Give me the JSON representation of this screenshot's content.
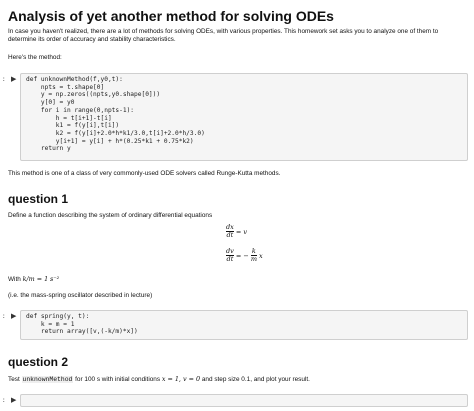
{
  "notebook": {
    "title": "Analysis of yet another method for solving ODEs",
    "intro": "In case you haven't realized, there are a lot of methods for solving ODEs, with various properties. This homework set asks you to analyze one of them to determine its order of accuracy and stability characteristics.",
    "method_label": "Here's the method:",
    "cell1_prompt": ":",
    "rk_note": "This method is one of a class of very commonly-used ODE solvers called Runge-Kutta methods.",
    "q1_heading": "question 1",
    "q1_text": "Define a function describing the system of ordinary differential equations",
    "eq1": {
      "num": "dx",
      "den": "dt",
      "rhs": "= v"
    },
    "eq2": {
      "num": "dv",
      "den": "dt",
      "eq": "= −",
      "knum": "k",
      "kden": "m",
      "tail": "x"
    },
    "with_prefix": "With",
    "with_math": "k/m = 1",
    "with_unit": "s⁻²",
    "mass_spring": "(i.e. the mass-spring oscillator described in lecture)",
    "cell2_prompt": ":",
    "q2_heading": "question 2",
    "q2_text_a": "Test",
    "q2_code": "unknownMethod",
    "q2_text_b": "for 100 s with initial conditions",
    "q2_math": "x = 1, v = 0",
    "q2_text_c": "and step size 0.1, and plot your result.",
    "cell3_prompt": ":"
  },
  "code1": [
    "def unknownMethod(f,y0,t):",
    "    npts = t.shape[0]",
    "    y = np.zeros((npts,y0.shape[0]))",
    "    y[0] = y0",
    "    for i in range(0,npts-1):",
    "        h = t[i+1]-t[i]",
    "        k1 = f(y[i],t[i])",
    "        k2 = f(y[i]+2.0*h*k1/3.0,t[i]+2.0*h/3.0)",
    "        y[i+1] = y[i] + h*(0.25*k1 + 0.75*k2)",
    "    return y"
  ],
  "code2": [
    "def spring(y, t):",
    "    k = m = 1",
    "    return array([v,(-k/m)*x])"
  ]
}
